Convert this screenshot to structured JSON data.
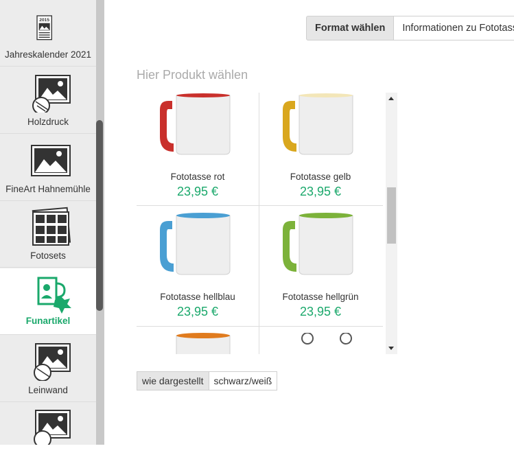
{
  "sidebar": {
    "items": [
      {
        "label": "Jahreskalender 2021",
        "icon": "calendar-icon"
      },
      {
        "label": "Holzdruck",
        "icon": "wood-print-icon"
      },
      {
        "label": "FineArt Hahnemühle",
        "icon": "fineart-print-icon"
      },
      {
        "label": "Fotosets",
        "icon": "photo-set-icon"
      },
      {
        "label": "Funartikel",
        "icon": "mug-gift-icon",
        "active": true
      },
      {
        "label": "Leinwand",
        "icon": "canvas-icon"
      },
      {
        "label": "",
        "icon": "print-stack-icon"
      }
    ],
    "calendar_year": "2015"
  },
  "tabs": [
    {
      "label": "Format wählen",
      "active": true
    },
    {
      "label": "Informationen zu Fototassen"
    }
  ],
  "heading": "Hier Produkt wählen",
  "products": [
    {
      "name": "Fototasse rot",
      "price": "23,95 €",
      "accent": "#c9302c"
    },
    {
      "name": "Fototasse gelb",
      "price": "23,95 €",
      "accent": "#d9a71e"
    },
    {
      "name": "Fototasse hellblau",
      "price": "23,95 €",
      "accent": "#4a9fd3"
    },
    {
      "name": "Fototasse hellgrün",
      "price": "23,95 €",
      "accent": "#7cb23a"
    },
    {
      "name": "",
      "price": "",
      "accent": "#e07b1e"
    },
    {
      "name": "",
      "price": "",
      "accent": "#555555"
    }
  ],
  "color_options": [
    {
      "label": "wie dargestellt",
      "active": true
    },
    {
      "label": "schwarz/weiß"
    }
  ],
  "colors": {
    "accent_green": "#1aa86b"
  }
}
